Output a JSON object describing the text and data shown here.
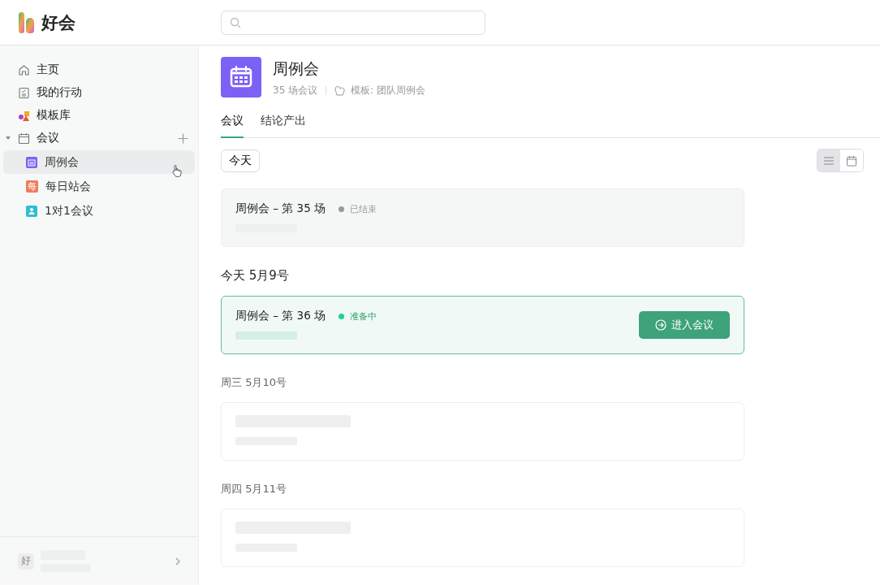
{
  "app": {
    "name": "好会"
  },
  "sidebar": {
    "items": [
      {
        "label": "主页"
      },
      {
        "label": "我的行动"
      },
      {
        "label": "模板库"
      },
      {
        "label": "会议",
        "expanded": true,
        "children": [
          {
            "label": "周例会",
            "color": "#7b61f5",
            "selected": true
          },
          {
            "label": "每日站会",
            "glyph": "每",
            "color": "#ee7d5b",
            "selected": false
          },
          {
            "label": "1对1会议",
            "color": "#2fbfcf",
            "selected": false
          }
        ]
      }
    ],
    "workspace": {
      "avatar": "好"
    }
  },
  "header": {
    "title": "周例会",
    "count": "35 场会议",
    "template": "模板: 团队周例会"
  },
  "tabs": [
    {
      "label": "会议",
      "selected": true
    },
    {
      "label": "结论产出",
      "selected": false
    }
  ],
  "today_button": "今天",
  "view_toggle": [
    {
      "kind": "list",
      "selected": true
    },
    {
      "kind": "calendar",
      "selected": false
    }
  ],
  "groups": [
    {
      "cards": [
        {
          "kind": "past",
          "title": "周例会 – 第 35 场",
          "status": "已结束",
          "color": "#999999"
        }
      ]
    },
    {
      "heading": "今天  5月9号",
      "is_today": true,
      "cards": [
        {
          "kind": "current",
          "title": "周例会 – 第 36 场",
          "status": "准备中",
          "color": "#1ed19a",
          "action": "进入会议"
        }
      ]
    },
    {
      "heading": "周三  5月10号",
      "is_today": false,
      "cards": [
        {
          "kind": "placeholder"
        }
      ]
    },
    {
      "heading": "周四  5月11号",
      "is_today": false,
      "cards": [
        {
          "kind": "placeholder"
        }
      ]
    }
  ]
}
